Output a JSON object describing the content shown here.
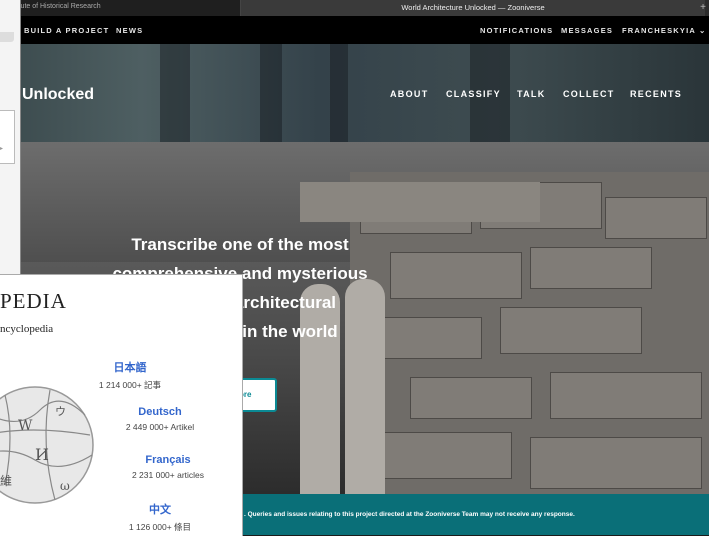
{
  "browser": {
    "left_tab": "| Institute of Historical Research",
    "active_tab": "World Architecture Unlocked — Zooniverse",
    "new_tab": "+"
  },
  "topnav": {
    "build": "BUILD A PROJECT",
    "news": "NEWS",
    "notifications": "NOTIFICATIONS",
    "messages": "MESSAGES",
    "user": "FRANCHESKYIA ⌄"
  },
  "project": {
    "title": "Unlocked",
    "nav": [
      "ABOUT",
      "CLASSIFY",
      "TALK",
      "COLLECT",
      "RECENTS"
    ]
  },
  "hero": {
    "headline_lines": [
      "Transcribe one of the most",
      "comprehensive and mysterious",
      "architectural",
      "in the world"
    ],
    "button": "ore"
  },
  "footer": {
    "text": ". Queries and issues relating to this project directed at the Zooniverse Team may not receive any response."
  },
  "wikipedia": {
    "title": "PEDIA",
    "subtitle": "ncyclopedia",
    "languages": [
      {
        "name": "日本語",
        "count": "1 214 000+ 記事"
      },
      {
        "name": "Deutsch",
        "count": "2 449 000+ Artikel"
      },
      {
        "name": "Français",
        "count": "2 231 000+ articles"
      },
      {
        "name": "中文",
        "count": "1 126 000+ 條目"
      }
    ]
  }
}
